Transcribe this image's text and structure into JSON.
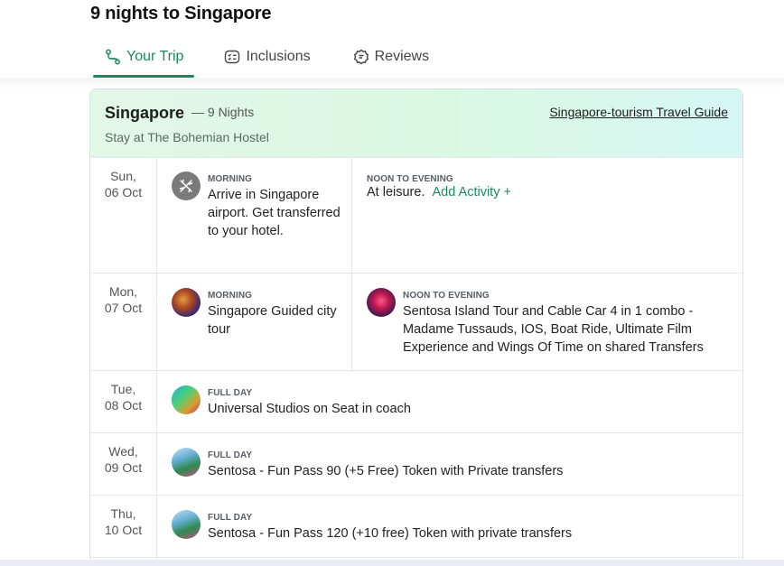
{
  "page": {
    "title": "9 nights to Singapore"
  },
  "tabs": [
    {
      "label": "Your Trip",
      "icon": "route-icon",
      "active": true
    },
    {
      "label": "Inclusions",
      "icon": "checklist-icon",
      "active": false
    },
    {
      "label": "Reviews",
      "icon": "review-badge-icon",
      "active": false
    }
  ],
  "destination": {
    "city": "Singapore",
    "nights": "— 9 Nights",
    "stay": "Stay at The Bohemian Hostel",
    "guide_link": "Singapore-tourism Travel Guide"
  },
  "itinerary": [
    {
      "day": "Sun,",
      "date": "06 Oct",
      "morning_label": "MORNING",
      "morning_text": "Arrive in Singapore airport. Get transferred to your hotel.",
      "evening_label": "NOON TO EVENING",
      "evening_text": "At leisure.",
      "add_activity": "Add Activity",
      "add_icon": "+"
    },
    {
      "day": "Mon,",
      "date": "07 Oct",
      "morning_label": "MORNING",
      "morning_text": "Singapore Guided city tour",
      "evening_label": "NOON TO EVENING",
      "evening_text": "Sentosa Island Tour and Cable Car 4 in 1 combo - Madame Tussauds, IOS, Boat Ride, Ultimate Film Experience and Wings Of Time on shared Transfers"
    },
    {
      "day": "Tue,",
      "date": "08 Oct",
      "label": "FULL DAY",
      "text": "Universal Studios on Seat in coach"
    },
    {
      "day": "Wed,",
      "date": "09 Oct",
      "label": "FULL DAY",
      "text": "Sentosa - Fun Pass 90 (+5 Free) Token with Private transfers"
    },
    {
      "day": "Thu,",
      "date": "10 Oct",
      "label": "FULL DAY",
      "text": "Sentosa - Fun Pass 120 (+10 free) Token with private transfers"
    }
  ],
  "colors": {
    "accent": "#1a8a5c",
    "header_gradient_start": "#e3f7e8",
    "header_gradient_end": "#d6f6f3"
  }
}
